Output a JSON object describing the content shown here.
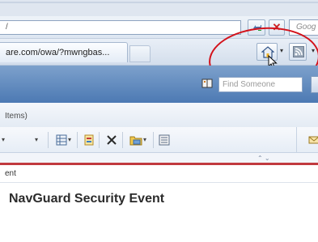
{
  "browser": {
    "address_text": "/",
    "search_placeholder": "Goog",
    "tab_title": "are.com/owa/?mwngbas...",
    "stop_glyph": "✕",
    "dropdown_glyph": "▾"
  },
  "owa": {
    "find_someone_placeholder": "Find Someone",
    "folder_items": "Items)",
    "event_label": "ent",
    "message_subject": "NavGuard Security Event"
  },
  "icons": {
    "refresh": "refresh-icon",
    "stop": "stop-icon",
    "home": "home-icon",
    "feeds": "rss-feed-icon",
    "address_book": "address-book-icon",
    "view": "view-icon",
    "categorize": "categorize-icon",
    "delete": "delete-icon",
    "move": "move-to-folder-icon",
    "folder_list": "folder-list-icon",
    "cursor": "mouse-cursor-icon"
  },
  "colors": {
    "owa_header": "#4c79b3",
    "annotation": "#d3121b",
    "subject_divider": "#c13a3f"
  }
}
